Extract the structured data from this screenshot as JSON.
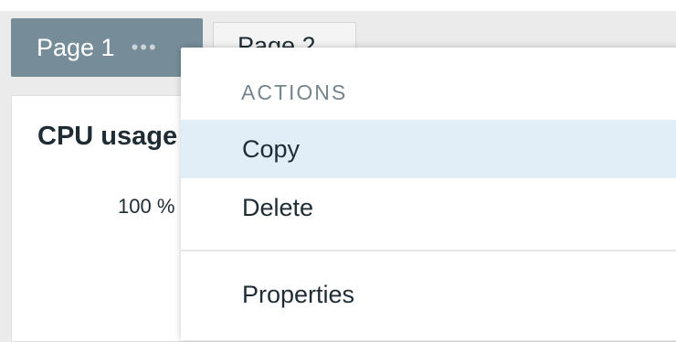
{
  "tabs": [
    {
      "label": "Page 1",
      "menu_icon": "•••"
    },
    {
      "label": "Page 2"
    }
  ],
  "widget": {
    "title": "CPU usage",
    "axis_tick": "100 %"
  },
  "context_menu": {
    "header": "ACTIONS",
    "items": [
      {
        "label": "Copy"
      },
      {
        "label": "Delete"
      },
      {
        "label": "Properties"
      }
    ]
  },
  "colors": {
    "active_tab": "#768d99",
    "menu_hover": "#e1eef8",
    "text": "#1f2c33",
    "menu_header": "#77858c"
  }
}
